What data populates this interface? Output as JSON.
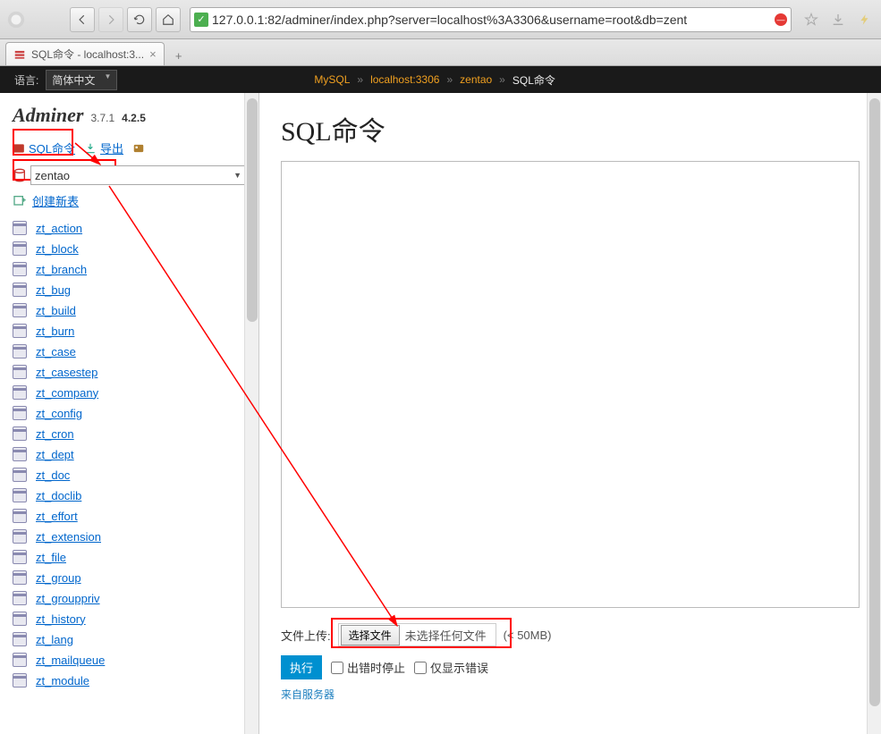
{
  "browser": {
    "url": "127.0.0.1:82/adminer/index.php?server=localhost%3A3306&username=root&db=zent",
    "tab_title": "SQL命令 - localhost:3...",
    "badge_check": "✓"
  },
  "topbar": {
    "lang_label": "语言:",
    "lang_value": "简体中文",
    "breadcrumb": [
      {
        "label": "MySQL",
        "link": true
      },
      {
        "label": "localhost:3306",
        "link": true
      },
      {
        "label": "zentao",
        "link": true
      },
      {
        "label": "SQL命令",
        "link": false
      }
    ]
  },
  "sidebar": {
    "logo": "Adminer",
    "ver1": "3.7.1",
    "ver2": "4.2.5",
    "sql_cmd": "SQL命令",
    "export": "导出",
    "db_selected": "zentao",
    "create_table": "创建新表",
    "tables": [
      "zt_action",
      "zt_block",
      "zt_branch",
      "zt_bug",
      "zt_build",
      "zt_burn",
      "zt_case",
      "zt_casestep",
      "zt_company",
      "zt_config",
      "zt_cron",
      "zt_dept",
      "zt_doc",
      "zt_doclib",
      "zt_effort",
      "zt_extension",
      "zt_file",
      "zt_group",
      "zt_grouppriv",
      "zt_history",
      "zt_lang",
      "zt_mailqueue",
      "zt_module"
    ]
  },
  "content": {
    "title": "SQL命令",
    "upload_label": "文件上传:",
    "file_button": "选择文件",
    "file_status": "未选择任何文件",
    "size_note": "(< 50MB)",
    "exec_button": "执行",
    "opt_stop_on_error": "出错时停止",
    "opt_show_errors_only": "仅显示错误",
    "from_server": "来自服务器"
  }
}
